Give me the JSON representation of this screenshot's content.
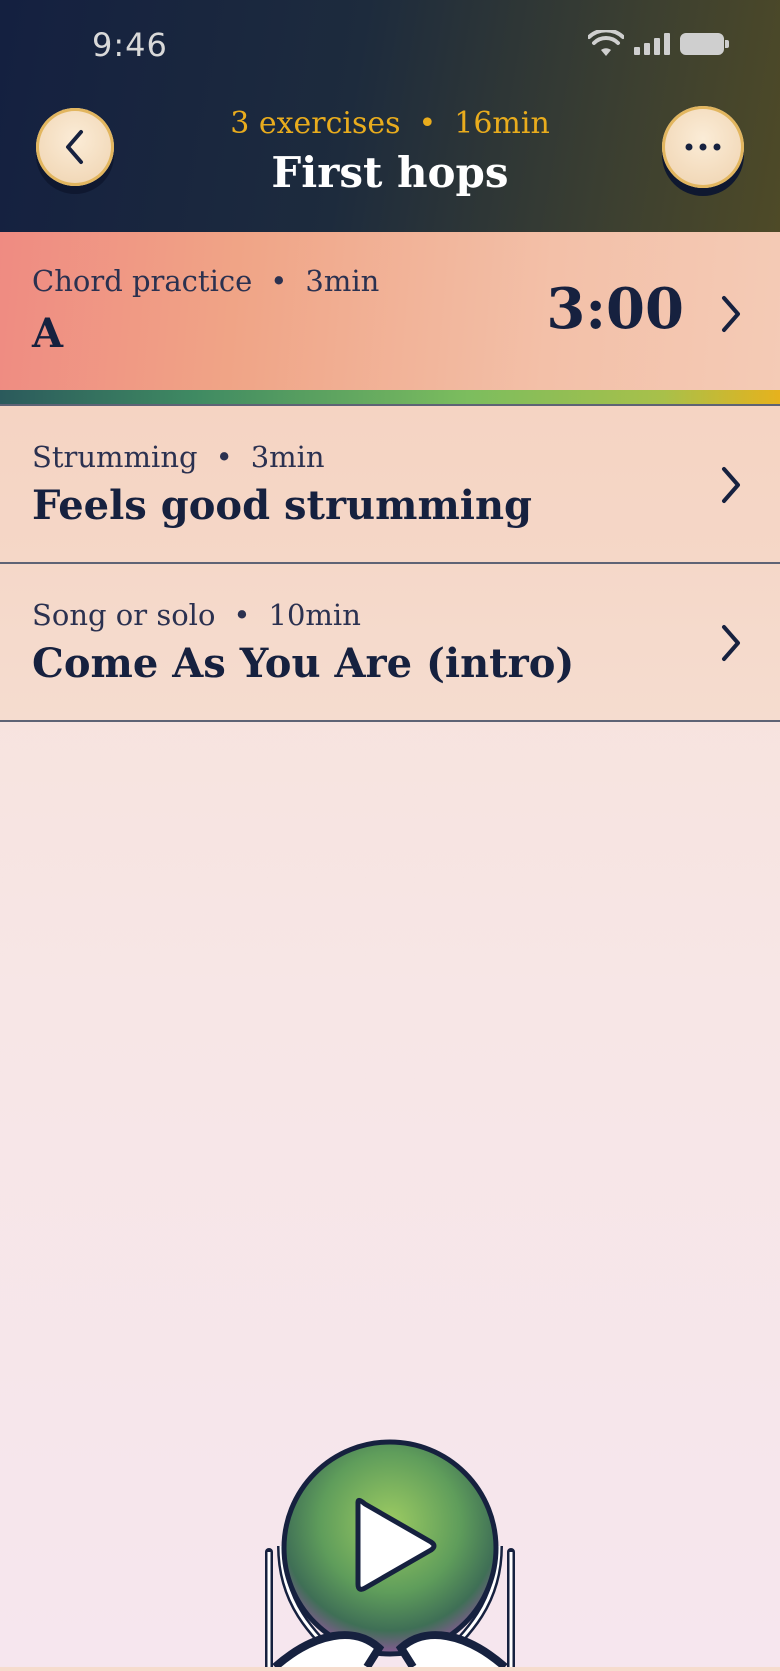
{
  "status_bar": {
    "time": "9:46"
  },
  "header": {
    "exercise_count": "3 exercises",
    "duration": "16min",
    "title": "First hops"
  },
  "exercises": [
    {
      "category": "Chord practice",
      "duration": "3min",
      "name": "A",
      "timer": "3:00",
      "active": true
    },
    {
      "category": "Strumming",
      "duration": "3min",
      "name": "Feels good strumming"
    },
    {
      "category": "Song or solo",
      "duration": "10min",
      "name": "Come As You Are (intro)"
    }
  ],
  "colors": {
    "header_dark": "#142040",
    "accent_gold": "#e9ac1d",
    "text_navy": "#16213f",
    "play_green": "#7cbd5e"
  },
  "icons": [
    "chevron-left-icon",
    "more-dots-icon",
    "chevron-right-icon",
    "play-icon",
    "wifi-icon",
    "signal-icon",
    "battery-icon"
  ]
}
